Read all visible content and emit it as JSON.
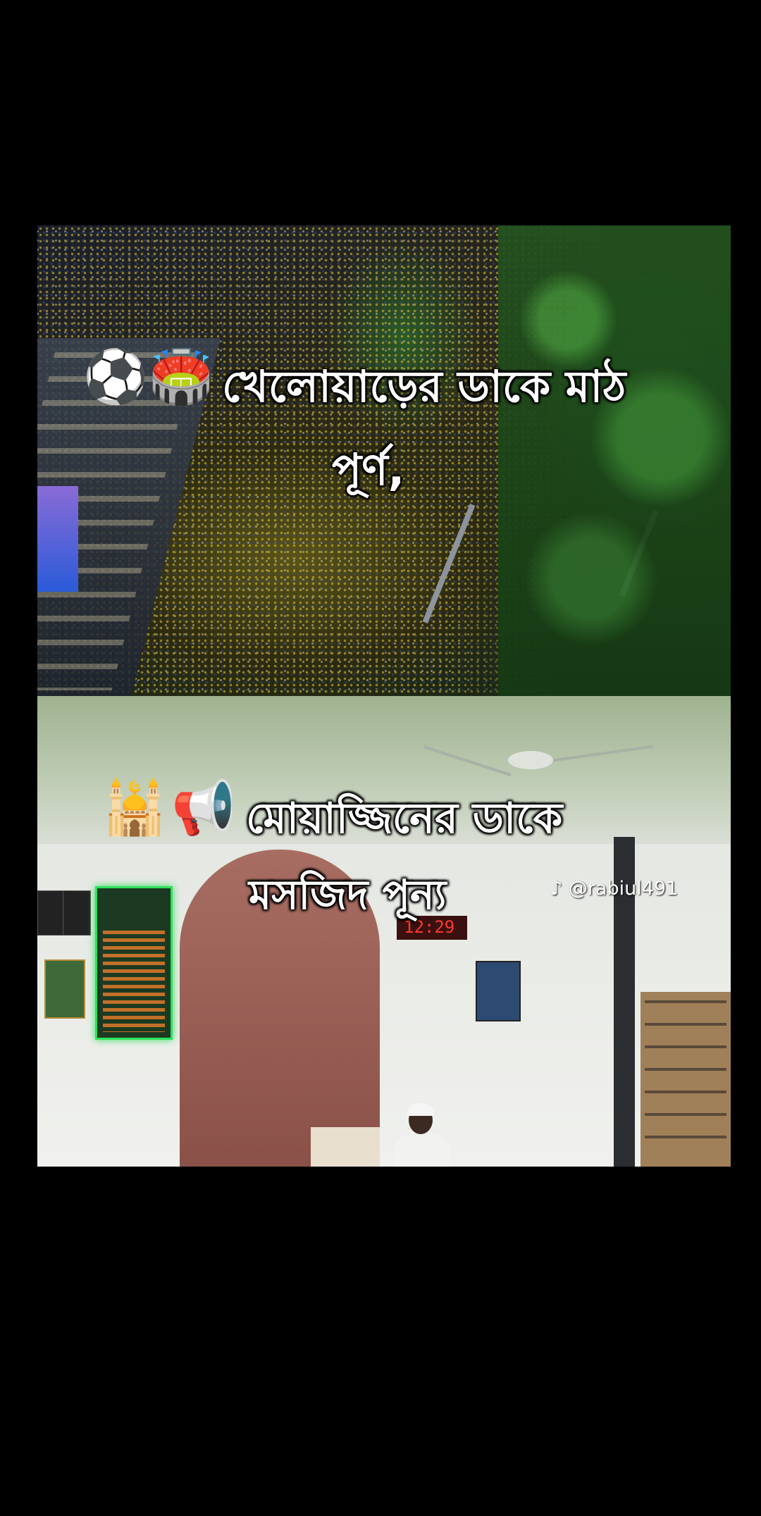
{
  "top_caption": {
    "icons": [
      "⚽",
      "🏟️"
    ],
    "line1": "খেলোয়াড়ের ডাকে মাঠ",
    "line2": "পূর্ণ,"
  },
  "bottom_caption": {
    "icons": [
      "🕌",
      "📢"
    ],
    "line1": "মোয়াজ্জিনের ডাকে",
    "line2": "মসজিদ পূন্য"
  },
  "watermark": {
    "icon": "♪",
    "handle": "@rabiul491"
  },
  "digital_clock": "12:29"
}
